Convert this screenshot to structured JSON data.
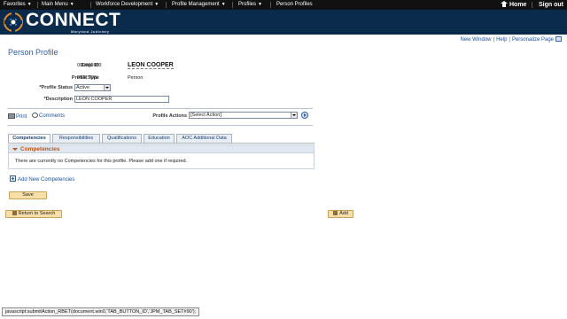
{
  "topnav": {
    "items": [
      {
        "label": "Favorites"
      },
      {
        "label": "Main Menu"
      },
      {
        "label": "Workforce Development"
      },
      {
        "label": "Profile Management"
      },
      {
        "label": "Profiles"
      },
      {
        "label": "Person Profiles"
      }
    ],
    "home": "Home",
    "signout": "Sign out"
  },
  "banner": {
    "logo_text": "CONNECT",
    "logo_sub": "Maryland Judiciary"
  },
  "utility": {
    "new_window": "New Window",
    "help": "Help",
    "personalize": "Personalize Page",
    "separator": "|"
  },
  "page": {
    "title": "Person Profile"
  },
  "fields": {
    "empl_id_label": "Empl ID",
    "empl_id": "000001683",
    "name": "LEON COOPER",
    "profile_type_label": "Profile Type",
    "profile_type": "PERSON",
    "profile_type_desc": "Person",
    "profile_status_label": "*Profile Status",
    "profile_status": "Active",
    "description_label": "*Description",
    "description": "LEON COOPER"
  },
  "actions": {
    "print": "Print",
    "comments": "Comments",
    "profile_actions_label": "Profile Actions",
    "profile_actions_value": "[Select Action]"
  },
  "tabs": [
    {
      "label": "Competencies",
      "active": true
    },
    {
      "label": "Responsibilities",
      "active": false
    },
    {
      "label": "Qualifications",
      "active": false
    },
    {
      "label": "Education",
      "active": false
    },
    {
      "label": "AOC Additional Data",
      "active": false
    }
  ],
  "competencies": {
    "title": "Competencies",
    "empty_message": "There are currently no Competencies for this profile.  Please add one if required.",
    "add_link": "Add New Competencies"
  },
  "buttons": {
    "save": "Save",
    "return": "Return to Search",
    "add": "Add"
  },
  "status_bar": "javascript:submitAction_RBET(document.win0,'TAB_BUTTON_ID','JPM_TAB_SET#90');",
  "colors": {
    "nav_bg": "#111111",
    "banner_bg": "#0b2b4c",
    "link": "#1a4fa0",
    "section_title": "#b3541e",
    "button_bg": "#f6dfa8"
  }
}
